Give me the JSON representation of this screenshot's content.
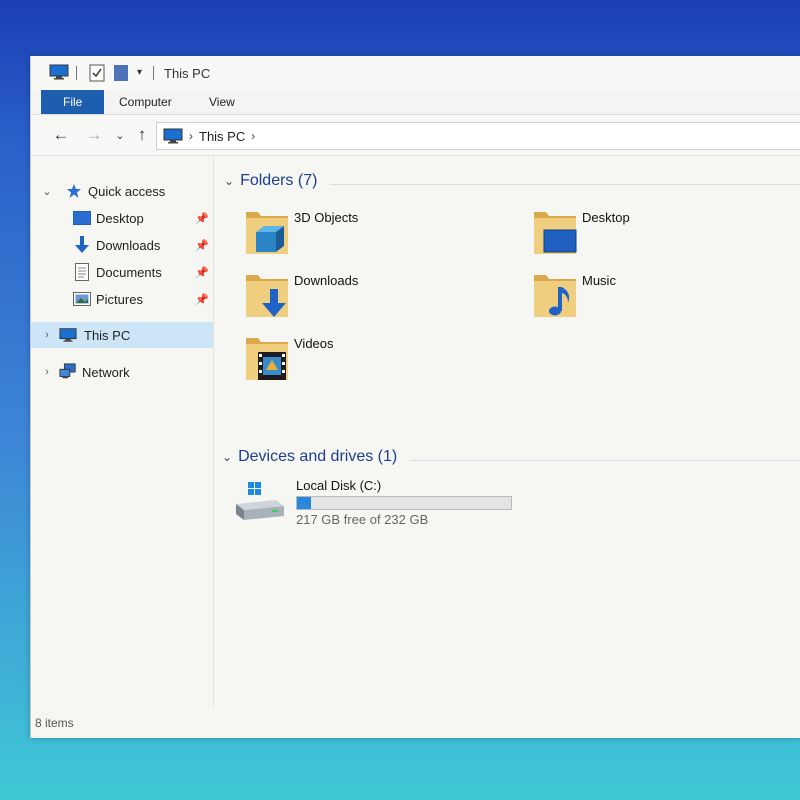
{
  "window": {
    "title": "This PC"
  },
  "ribbon": {
    "tabs": [
      "File",
      "Computer",
      "View"
    ]
  },
  "address": {
    "crumbs": [
      "This PC"
    ]
  },
  "navpane": {
    "quick_access": "Quick access",
    "pinned": [
      {
        "label": "Desktop",
        "icon": "desktop-icon"
      },
      {
        "label": "Downloads",
        "icon": "download-arrow-icon"
      },
      {
        "label": "Documents",
        "icon": "document-icon"
      },
      {
        "label": "Pictures",
        "icon": "picture-icon"
      }
    ],
    "this_pc": "This PC",
    "network": "Network"
  },
  "folders": {
    "header": "Folders (7)",
    "items": [
      {
        "label": "3D Objects",
        "icon": "3d-objects-folder-icon"
      },
      {
        "label": "Desktop",
        "icon": "desktop-folder-icon"
      },
      {
        "label": "Downloads",
        "icon": "downloads-folder-icon"
      },
      {
        "label": "Music",
        "icon": "music-folder-icon"
      },
      {
        "label": "Videos",
        "icon": "videos-folder-icon"
      }
    ]
  },
  "devices": {
    "header": "Devices and drives (1)",
    "drive": {
      "name": "Local Disk (C:)",
      "free_text": "217 GB free of 232 GB",
      "used_fraction": 0.065
    }
  },
  "status": {
    "items": "8 items"
  },
  "colors": {
    "accent": "#1d5fae",
    "selection": "#cde6f7",
    "progress": "#2b87da",
    "folder": "#e8c66a"
  }
}
